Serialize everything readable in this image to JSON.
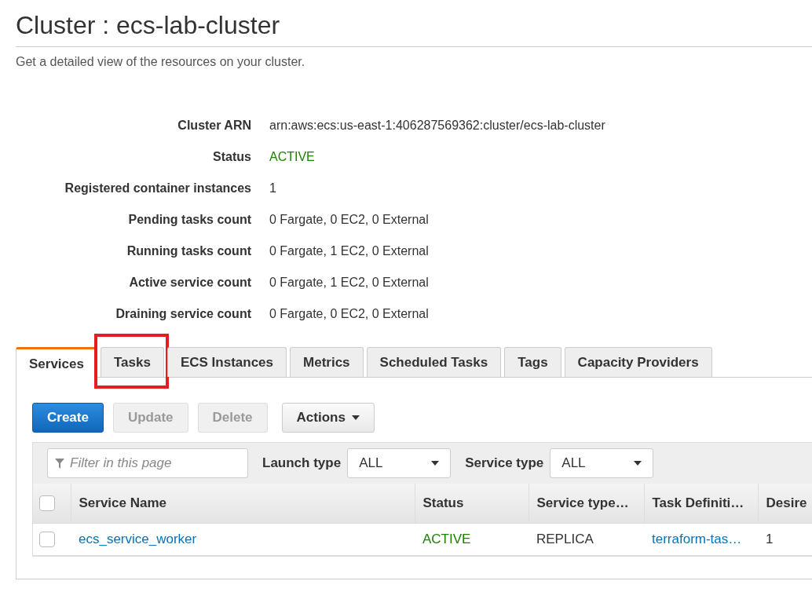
{
  "page": {
    "title": "Cluster : ecs-lab-cluster",
    "subtitle": "Get a detailed view of the resources on your cluster."
  },
  "details": [
    {
      "label": "Cluster ARN",
      "value": "arn:aws:ecs:us-east-1:406287569362:cluster/ecs-lab-cluster",
      "kind": "text"
    },
    {
      "label": "Status",
      "value": "ACTIVE",
      "kind": "status"
    },
    {
      "label": "Registered container instances",
      "value": "1",
      "kind": "text"
    },
    {
      "label": "Pending tasks count",
      "value": "0 Fargate, 0 EC2, 0 External",
      "kind": "text"
    },
    {
      "label": "Running tasks count",
      "value": "0 Fargate, 1 EC2, 0 External",
      "kind": "text"
    },
    {
      "label": "Active service count",
      "value": "0 Fargate, 1 EC2, 0 External",
      "kind": "text"
    },
    {
      "label": "Draining service count",
      "value": "0 Fargate, 0 EC2, 0 External",
      "kind": "text"
    }
  ],
  "tabs": [
    {
      "label": "Services",
      "selected": true,
      "highlighted": false
    },
    {
      "label": "Tasks",
      "selected": false,
      "highlighted": true
    },
    {
      "label": "ECS Instances",
      "selected": false,
      "highlighted": false
    },
    {
      "label": "Metrics",
      "selected": false,
      "highlighted": false
    },
    {
      "label": "Scheduled Tasks",
      "selected": false,
      "highlighted": false
    },
    {
      "label": "Tags",
      "selected": false,
      "highlighted": false
    },
    {
      "label": "Capacity Providers",
      "selected": false,
      "highlighted": false
    }
  ],
  "buttons": [
    {
      "label": "Create",
      "kind": "primary",
      "disabled": false
    },
    {
      "label": "Update",
      "kind": "default",
      "disabled": true
    },
    {
      "label": "Delete",
      "kind": "default",
      "disabled": true
    },
    {
      "label": "Actions",
      "kind": "dropdown",
      "disabled": false
    }
  ],
  "filter": {
    "placeholder": "Filter in this page",
    "launch_type": {
      "label": "Launch type",
      "value": "ALL"
    },
    "service_type": {
      "label": "Service type",
      "value": "ALL"
    }
  },
  "table": {
    "select_all_checked": false,
    "columns": [
      "Service Name",
      "Status",
      "Service type…",
      "Task Definiti…",
      "Desire"
    ],
    "rows": [
      {
        "checked": false,
        "cells": [
          {
            "text": "ecs_service_worker",
            "kind": "link"
          },
          {
            "text": "ACTIVE",
            "kind": "status"
          },
          {
            "text": "REPLICA",
            "kind": "text"
          },
          {
            "text": "terraform-tas…",
            "kind": "link"
          },
          {
            "text": "1",
            "kind": "text"
          }
        ]
      }
    ]
  }
}
